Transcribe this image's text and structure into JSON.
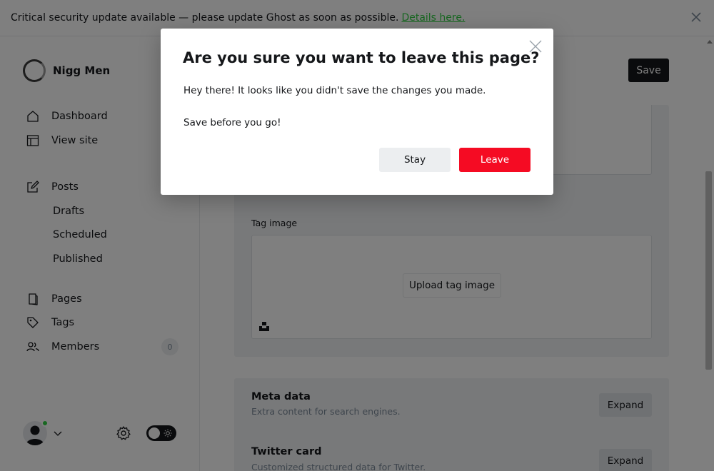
{
  "banner": {
    "message": "Critical security update available — please update Ghost as soon as possible.",
    "link_text": "Details here."
  },
  "sidebar": {
    "site_name": "Nigg Men",
    "nav": {
      "dashboard": "Dashboard",
      "view_site": "View site",
      "posts": "Posts",
      "drafts": "Drafts",
      "scheduled": "Scheduled",
      "published": "Published",
      "pages": "Pages",
      "tags": "Tags",
      "members": "Members",
      "members_count": "0"
    },
    "icons": [
      "home-icon",
      "view-site-icon",
      "posts-icon",
      "pages-icon",
      "tags-icon",
      "members-icon",
      "user-avatar-icon",
      "chevron-down-icon",
      "gear-icon",
      "sun-icon"
    ]
  },
  "main": {
    "save_label": "Save",
    "tag_image_label": "Tag image",
    "upload_label": "Upload tag image",
    "meta": {
      "title": "Meta data",
      "desc": "Extra content for search engines.",
      "expand": "Expand"
    },
    "twitter": {
      "title": "Twitter card",
      "desc": "Customized structured data for Twitter.",
      "expand": "Expand"
    }
  },
  "modal": {
    "title": "Are you sure you want to leave this page?",
    "body1": "Hey there! It looks like you didn't save the changes you made.",
    "body2": "Save before you go!",
    "stay": "Stay",
    "leave": "Leave"
  },
  "colors": {
    "accent_green": "#30cf43",
    "danger_red": "#f50b23",
    "dark": "#15171a"
  }
}
